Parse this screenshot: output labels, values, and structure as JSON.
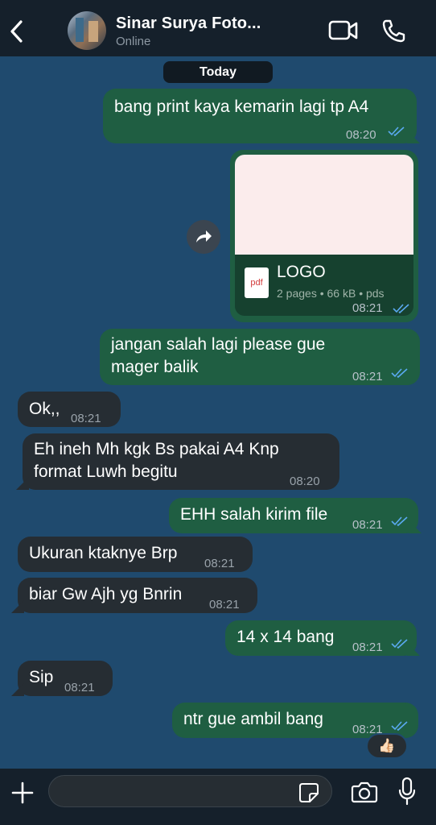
{
  "header": {
    "contact_name": "Sinar Surya Foto...",
    "status": "Online",
    "icons": [
      "back-arrow-icon",
      "video-camera-icon",
      "phone-icon"
    ]
  },
  "chat": {
    "date_label": "Today",
    "messages": [
      {
        "direction": "out",
        "text": "bang print kaya kemarin lagi tp A4",
        "time": "08:20",
        "read": true
      },
      {
        "direction": "out",
        "type": "file",
        "file_name": "LOGO",
        "file_icon": "pdf",
        "meta": "2 pages • 66 kB • pds",
        "time": "08:21",
        "read": true
      },
      {
        "direction": "out",
        "text_line1": "jangan salah lagi please gue",
        "text_line2": "mager balik",
        "time": "08:21",
        "read": true
      },
      {
        "direction": "in",
        "text": "Ok,,",
        "time": "08:21"
      },
      {
        "direction": "in",
        "text_line1": "Eh ineh Mh kgk Bs pakai A4 Knp",
        "text_line2": "format Luwh begitu",
        "time": "08:20"
      },
      {
        "direction": "out",
        "text": "EHH salah kirim file",
        "time": "08:21",
        "read": true
      },
      {
        "direction": "in",
        "text": "Ukuran ktaknye Brp",
        "time": "08:21"
      },
      {
        "direction": "in",
        "text": "biar Gw Ajh yg Bnrin",
        "time": "08:21"
      },
      {
        "direction": "out",
        "text": "14 x 14 bang",
        "time": "08:21",
        "read": true
      },
      {
        "direction": "in",
        "text": "Sip",
        "time": "08:21"
      },
      {
        "direction": "out",
        "text": "ntr gue ambil bang",
        "time": "08:21",
        "read": true,
        "reaction": "👍🏻"
      }
    ]
  },
  "composer": {
    "placeholder": "",
    "icons": [
      "plus-icon",
      "sticker-icon",
      "camera-icon",
      "microphone-icon"
    ]
  },
  "colors": {
    "background": "#1f4a6e",
    "outgoing_bubble": "#1f5e42",
    "incoming_bubble": "#262d33",
    "header_bar": "#15202b",
    "read_tick": "#5aa9f0"
  }
}
